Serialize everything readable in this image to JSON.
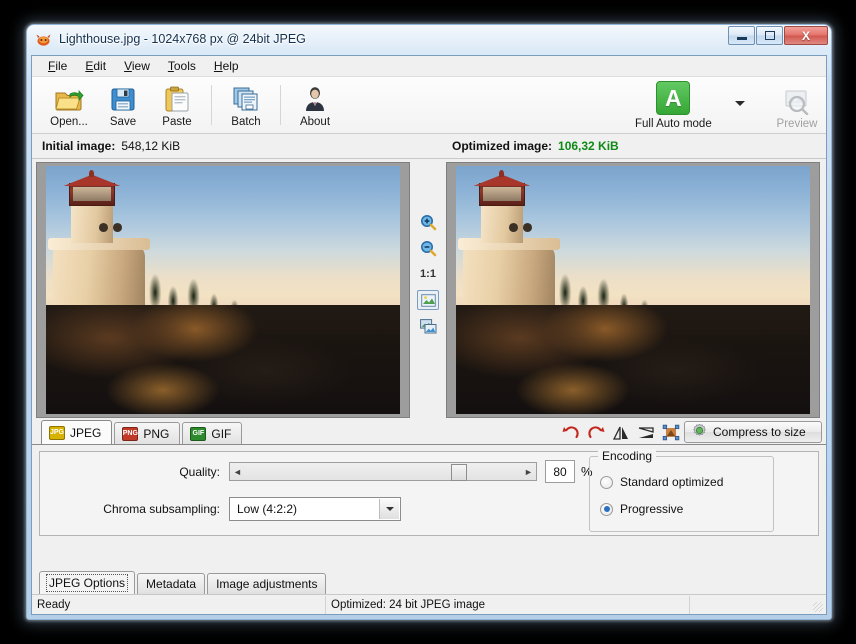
{
  "window": {
    "title": "Lighthouse.jpg - 1024x768 px @ 24bit JPEG",
    "app_icon": "riot-app-icon",
    "controls": {
      "minimize": "minimize-icon",
      "maximize": "maximize-icon",
      "close": "X"
    }
  },
  "menu": {
    "items": [
      {
        "label": "File",
        "mnemonic": "F"
      },
      {
        "label": "Edit",
        "mnemonic": "E"
      },
      {
        "label": "View",
        "mnemonic": "V"
      },
      {
        "label": "Tools",
        "mnemonic": "T"
      },
      {
        "label": "Help",
        "mnemonic": "H"
      }
    ]
  },
  "toolbar": {
    "buttons": [
      {
        "label": "Open...",
        "icon": "open-folder-icon",
        "disabled": false
      },
      {
        "label": "Save",
        "icon": "floppy-save-icon",
        "disabled": false
      },
      {
        "label": "Paste",
        "icon": "clipboard-paste-icon",
        "disabled": false
      },
      {
        "label": "Batch",
        "icon": "batch-documents-icon",
        "disabled": false
      },
      {
        "label": "About",
        "icon": "person-about-icon",
        "disabled": false
      }
    ],
    "auto_mode": {
      "label": "Full Auto mode",
      "badge": "A",
      "badge_color": "#35a735",
      "caret": "chevron-down-icon"
    },
    "preview": {
      "label": "Preview",
      "icon": "magnifier-preview-icon",
      "disabled": true
    }
  },
  "info": {
    "initial_label": "Initial image:",
    "initial_value": "548,12 KiB",
    "optimized_label": "Optimized image:",
    "optimized_value": "106,32 KiB",
    "optimized_color": "#0f8a17"
  },
  "preview_tools": {
    "items": [
      {
        "name": "zoom-in-icon",
        "label": ""
      },
      {
        "name": "zoom-out-icon",
        "label": ""
      },
      {
        "name": "zoom-actual-label",
        "label": "1:1"
      },
      {
        "name": "fit-to-window-icon",
        "label": ""
      },
      {
        "name": "compare-view-icon",
        "label": ""
      }
    ]
  },
  "format_tabs": {
    "tabs": [
      {
        "label": "JPEG",
        "badge": "JPG",
        "active": true
      },
      {
        "label": "PNG",
        "badge": "PNG",
        "active": false
      },
      {
        "label": "GIF",
        "badge": "GIF",
        "active": false
      }
    ]
  },
  "edit_tools": {
    "items": [
      {
        "name": "rotate-left-icon"
      },
      {
        "name": "rotate-right-icon"
      },
      {
        "name": "flip-horizontal-icon"
      },
      {
        "name": "flip-vertical-icon"
      },
      {
        "name": "crop-icon"
      }
    ],
    "compress_button": {
      "label": "Compress to size",
      "icon": "gear-compress-icon"
    }
  },
  "jpeg_options": {
    "quality_label": "Quality:",
    "quality_value": "80",
    "quality_percent_sign": "%",
    "quality_min": 0,
    "quality_max": 100,
    "slider_left_arrow": "◄",
    "slider_right_arrow": "►",
    "chroma_label": "Chroma subsampling:",
    "chroma_value": "Low (4:2:2)",
    "chroma_options": [
      "Low (4:2:2)"
    ],
    "encoding": {
      "title": "Encoding",
      "options": [
        {
          "label": "Standard optimized",
          "selected": false
        },
        {
          "label": "Progressive",
          "selected": true
        }
      ]
    }
  },
  "bottom_tabs": {
    "tabs": [
      {
        "label": "JPEG Options",
        "active": true
      },
      {
        "label": "Metadata",
        "active": false
      },
      {
        "label": "Image adjustments",
        "active": false
      }
    ]
  },
  "statusbar": {
    "left": "Ready",
    "middle": "Optimized: 24 bit JPEG image",
    "right": ""
  }
}
